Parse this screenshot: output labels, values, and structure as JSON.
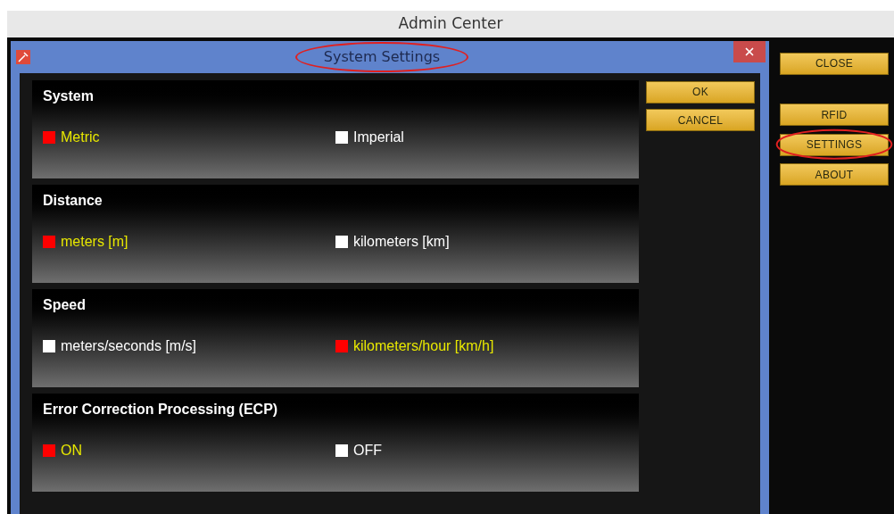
{
  "window": {
    "title": "Admin Center"
  },
  "dialog": {
    "title": "System Settings",
    "title_highlighted": true,
    "sections": [
      {
        "heading": "System",
        "options": [
          {
            "label": "Metric",
            "selected": true
          },
          {
            "label": "Imperial",
            "selected": false
          }
        ]
      },
      {
        "heading": "Distance",
        "options": [
          {
            "label": "meters [m]",
            "selected": true
          },
          {
            "label": "kilometers [km]",
            "selected": false
          }
        ]
      },
      {
        "heading": "Speed",
        "options": [
          {
            "label": "meters/seconds [m/s]",
            "selected": false
          },
          {
            "label": "kilometers/hour [km/h]",
            "selected": true
          }
        ]
      },
      {
        "heading": "Error Correction Processing (ECP)",
        "options": [
          {
            "label": "ON",
            "selected": true
          },
          {
            "label": "OFF",
            "selected": false
          }
        ]
      }
    ],
    "buttons": [
      "OK",
      "CANCEL"
    ]
  },
  "side_buttons": [
    {
      "label": "CLOSE",
      "highlighted": false
    },
    {
      "label": "RFID",
      "highlighted": false
    },
    {
      "label": "SETTINGS",
      "highlighted": true
    },
    {
      "label": "ABOUT",
      "highlighted": false
    }
  ]
}
